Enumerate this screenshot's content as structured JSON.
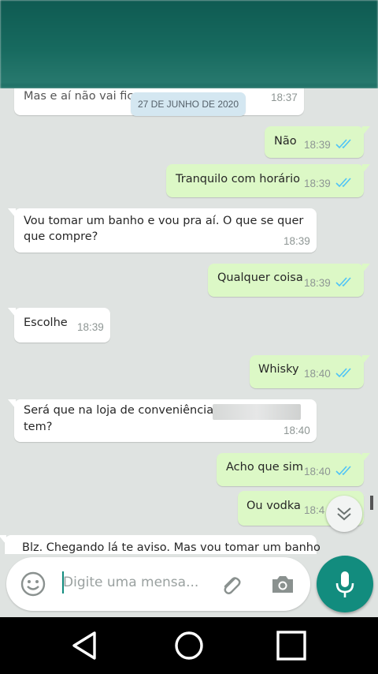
{
  "date_chip": "27 DE JUNHO DE 2020",
  "messages": [
    {
      "text": "Mas e aí não vai fica",
      "time": "18:37",
      "dir": "in",
      "partial": true
    },
    {
      "text": "Não",
      "time": "18:39",
      "dir": "out",
      "read": true
    },
    {
      "text": "Tranquilo com horário",
      "time": "18:39",
      "dir": "out",
      "read": true
    },
    {
      "text": "Vou tomar um banho e vou pra aí. O que se quer que compre?",
      "time": "18:39",
      "dir": "in"
    },
    {
      "text": "Qualquer coisa",
      "time": "18:39",
      "dir": "out",
      "read": true
    },
    {
      "text": "Escolhe",
      "time": "18:39",
      "dir": "in"
    },
    {
      "text": "Whisky",
      "time": "18:40",
      "dir": "out",
      "read": true
    },
    {
      "text": "Será que na loja de conveniência do",
      "text2": "tem?",
      "time": "18:40",
      "dir": "in",
      "redacted": true
    },
    {
      "text": "Acho que sim",
      "time": "18:40",
      "dir": "out",
      "read": true
    },
    {
      "text": "Ou vodka",
      "time": "18:4",
      "dir": "out"
    },
    {
      "text": "Blz. Chegando lá te aviso. Mas vou tomar um banho",
      "dir": "in",
      "partial": true
    }
  ],
  "composer": {
    "placeholder": "Digite uma mensa..."
  },
  "icons": {
    "emoji": "emoji-icon",
    "attach": "paperclip-icon",
    "camera": "camera-icon",
    "mic": "microphone-icon",
    "scroll": "double-chevron-down-icon",
    "read_receipt": "double-check-icon"
  },
  "colors": {
    "accent": "#128c7e",
    "outgoing_bubble": "#dcf8c6",
    "incoming_bubble": "#ffffff",
    "read_tick": "#4fc3f7",
    "chat_background": "#dfe3e1",
    "date_chip": "#d4e7f1"
  }
}
